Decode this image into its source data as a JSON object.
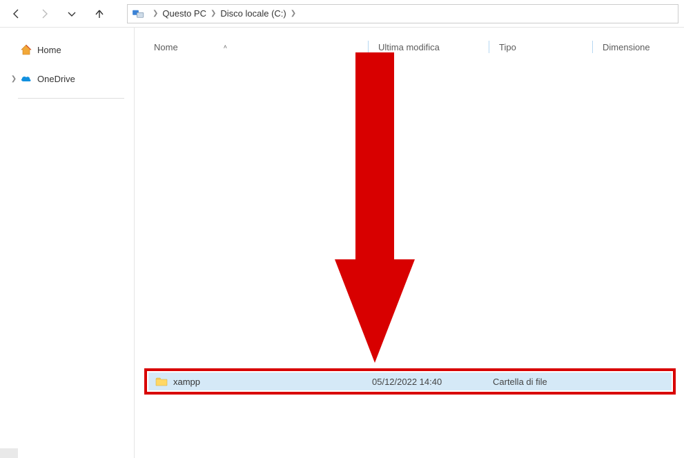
{
  "breadcrumb": {
    "items": [
      "Questo PC",
      "Disco locale (C:)"
    ]
  },
  "sidebar": {
    "items": [
      {
        "label": "Home",
        "icon": "home",
        "expandable": false
      },
      {
        "label": "OneDrive",
        "icon": "onedrive",
        "expandable": true
      }
    ]
  },
  "columns": {
    "name": "Nome",
    "modified": "Ultima modifica",
    "type": "Tipo",
    "size": "Dimensione"
  },
  "highlighted_file": {
    "name": "xampp",
    "modified": "05/12/2022 14:40",
    "type": "Cartella di file"
  }
}
